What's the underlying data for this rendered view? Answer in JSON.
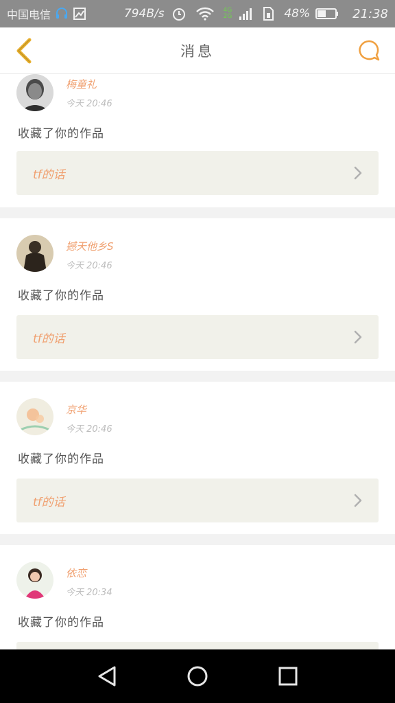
{
  "status_bar": {
    "carrier": "中国电信",
    "network_speed": "794B/s",
    "badge_4g_top": "4G",
    "badge_4g_bottom": "2G",
    "battery_percent": "48%",
    "battery_level": 0.48,
    "time": "21:38"
  },
  "header": {
    "title": "消息",
    "back_icon": "chevron-left-icon",
    "chat_icon": "chat-bubble-icon",
    "accent_color": "#f0a040"
  },
  "messages": [
    {
      "user": "梅童礼",
      "time": "今天 20:46",
      "action": "收藏了你的作品",
      "work_title": "tf的话"
    },
    {
      "user": "撼天他乡S",
      "time": "今天 20:46",
      "action": "收藏了你的作品",
      "work_title": "tf的话"
    },
    {
      "user": "京华",
      "time": "今天 20:46",
      "action": "收藏了你的作品",
      "work_title": "tf的话"
    },
    {
      "user": "依恋",
      "time": "今天 20:34",
      "action": "收藏了你的作品",
      "work_title": ""
    }
  ],
  "nav_bar": {
    "back_icon": "triangle-back-icon",
    "home_icon": "circle-home-icon",
    "recents_icon": "square-recents-icon"
  }
}
